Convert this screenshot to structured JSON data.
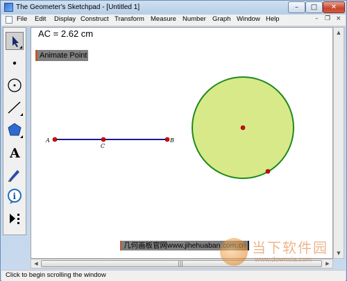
{
  "window": {
    "title": "The Geometer's Sketchpad - [Untitled 1]",
    "minimize_label": "–",
    "maximize_label": "□",
    "close_label": "✕"
  },
  "menu": {
    "items": [
      "File",
      "Edit",
      "Display",
      "Construct",
      "Transform",
      "Measure",
      "Number",
      "Graph",
      "Window",
      "Help"
    ],
    "doc_min": "–",
    "doc_restore": "❐",
    "doc_close": "×"
  },
  "tools": [
    {
      "name": "arrow-select-tool",
      "selected": true
    },
    {
      "name": "point-tool",
      "selected": false
    },
    {
      "name": "compass-tool",
      "selected": false
    },
    {
      "name": "straightedge-tool",
      "selected": false
    },
    {
      "name": "polygon-tool",
      "selected": false
    },
    {
      "name": "text-tool",
      "selected": false,
      "glyph": "A"
    },
    {
      "name": "marker-tool",
      "selected": false
    },
    {
      "name": "information-tool",
      "selected": false,
      "glyph": "i"
    },
    {
      "name": "custom-tool",
      "selected": false
    }
  ],
  "sketch": {
    "measurement": "AC = 2.62 cm",
    "animate_button": "Animate Point",
    "points": {
      "A": "A",
      "B": "B",
      "C": "C"
    },
    "watermark_box": "几何画板官网www.jihehuaban.com.cn"
  },
  "colors": {
    "segment": "#1a1a8c",
    "point": "#e00000",
    "circle_fill": "#d8e98a",
    "circle_stroke": "#1c8a1c",
    "button_gray": "#808080"
  },
  "status": {
    "text": "Click to begin scrolling the window"
  },
  "scrollbars": {
    "grip": "|||",
    "up": "▲",
    "down": "▼",
    "left": "◀",
    "right": "▶"
  },
  "overlay_brand": {
    "name_cn": "当下软件园",
    "url": "www.downxia.com"
  }
}
